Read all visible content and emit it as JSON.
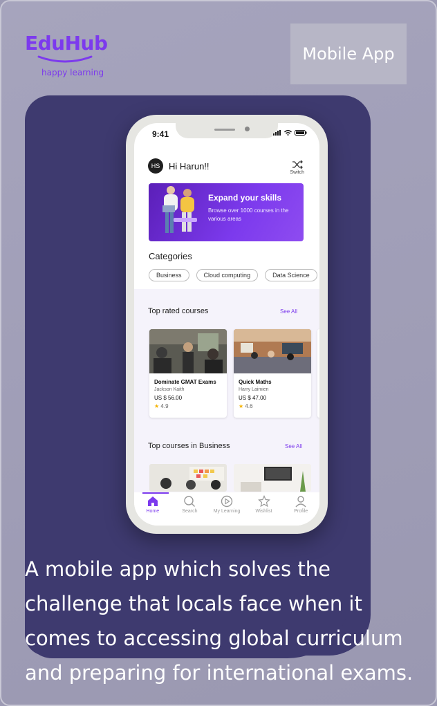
{
  "brand": {
    "name": "EduHub",
    "tagline": "happy learning",
    "color": "#7c3aed"
  },
  "badge": {
    "label": "Mobile App"
  },
  "description": "A mobile app which solves the challenge that locals face when it comes to accessing global curriculum and preparing for international exams.",
  "phone": {
    "status_time": "9:41",
    "user_initials": "HS",
    "greeting": "Hi Harun!!",
    "switch_label": "Switch",
    "banner": {
      "title": "Expand your skills",
      "subtitle": "Browse over 1000 courses in the various areas"
    },
    "categories_title": "Categories",
    "categories": [
      "Business",
      "Cloud computing",
      "Data Science"
    ],
    "top_rated": {
      "title": "Top rated courses",
      "see_all": "See All",
      "courses": [
        {
          "title": "Dominate GMAT Exams",
          "author": "Jackson Kaith",
          "price": "US $ 56.00",
          "rating": "4.9"
        },
        {
          "title": "Quick Maths",
          "author": "Harry  Laimien",
          "price": "US $ 47.00",
          "rating": "4.6"
        }
      ]
    },
    "business": {
      "title": "Top courses in  Business",
      "see_all": "See All"
    },
    "tabs": [
      {
        "label": "Home",
        "icon": "home-icon",
        "active": true
      },
      {
        "label": "Search",
        "icon": "search-icon"
      },
      {
        "label": "My Learning",
        "icon": "play-circle-icon"
      },
      {
        "label": "Wishlist",
        "icon": "star-icon"
      },
      {
        "label": "Profile",
        "icon": "user-icon"
      }
    ]
  }
}
